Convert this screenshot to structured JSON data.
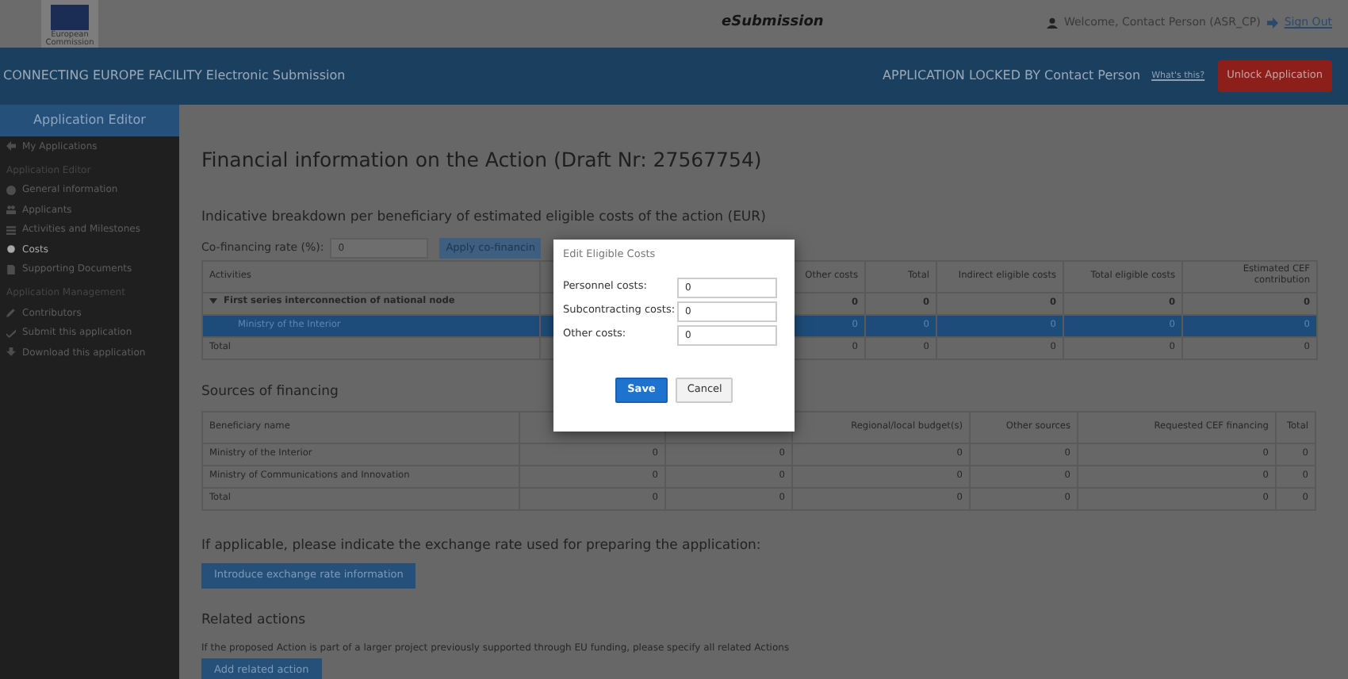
{
  "header": {
    "logo_caption": "European Commission",
    "app_title": "eSubmission",
    "user": "Welcome, Contact Person (ASR_CP)",
    "sign_out": "Sign Out"
  },
  "banner": {
    "title": "CONNECTING EUROPE FACILITY Electronic Submission",
    "lock_status": "APPLICATION LOCKED BY Contact Person",
    "help_link": "What's this?",
    "unlock_button": "Unlock Application"
  },
  "sidebar": {
    "title": "Application Editor",
    "items": [
      {
        "kind": "link",
        "label": "My Applications",
        "selected": false
      },
      {
        "kind": "section",
        "label": "Application Editor"
      },
      {
        "kind": "link",
        "label": "General information",
        "selected": false
      },
      {
        "kind": "link",
        "label": "Applicants",
        "selected": false
      },
      {
        "kind": "link",
        "label": "Activities and Milestones",
        "selected": false
      },
      {
        "kind": "link",
        "label": "Costs",
        "selected": true
      },
      {
        "kind": "link",
        "label": "Supporting Documents",
        "selected": false
      },
      {
        "kind": "section",
        "label": "Application Management"
      },
      {
        "kind": "link",
        "label": "Contributors",
        "selected": false
      },
      {
        "kind": "link",
        "label": "Submit this application",
        "selected": false
      },
      {
        "kind": "link",
        "label": "Download this application",
        "selected": false
      }
    ]
  },
  "page_title": "Financial information on the Action (Draft Nr: 27567754)",
  "breakdown": {
    "title": "Indicative breakdown per beneficiary of estimated eligible costs of the action (EUR)",
    "rate_label": "Co-financing rate (%):",
    "rate_value": "0",
    "apply_button": "Apply co-financin",
    "columns": [
      "Activities",
      "",
      "",
      "Other costs",
      "Total",
      "Indirect eligible costs",
      "Total eligible costs",
      "Estimated CEF contribution"
    ],
    "rows": [
      {
        "kind": "group",
        "expanded": true,
        "selected": false,
        "name": "First series interconnection of national node",
        "values": [
          "0",
          "0",
          "0",
          "0",
          "0"
        ]
      },
      {
        "kind": "item",
        "selected": true,
        "name": "Ministry of the Interior",
        "values": [
          "0",
          "0",
          "0",
          "0",
          "0"
        ]
      },
      {
        "kind": "total",
        "selected": false,
        "name": "Total",
        "values": [
          "0",
          "0",
          "0",
          "0",
          "0"
        ]
      }
    ]
  },
  "sources": {
    "title": "Sources of financing",
    "columns": [
      "Beneficiary name",
      "",
      "",
      "Regional/local budget(s)",
      "Other sources",
      "Requested CEF financing",
      "Total"
    ],
    "rows": [
      {
        "name": "Ministry of the Interior",
        "values": [
          "0",
          "0",
          "0",
          "0",
          "0",
          "0"
        ]
      },
      {
        "name": "Ministry of Communications and Innovation",
        "values": [
          "0",
          "0",
          "0",
          "0",
          "0",
          "0"
        ]
      },
      {
        "name": "Total",
        "values": [
          "0",
          "0",
          "0",
          "0",
          "0",
          "0"
        ]
      }
    ]
  },
  "exchange": {
    "text": "If applicable, please indicate the exchange rate used for preparing the application:",
    "button": "Introduce exchange rate information"
  },
  "related": {
    "title": "Related actions",
    "text": "If the proposed Action is part of a larger project previously supported through EU funding, please specify all related Actions",
    "button": "Add related action"
  },
  "dialog": {
    "title": "Edit Eligible Costs",
    "fields": [
      {
        "label": "Personnel costs:",
        "value": "0"
      },
      {
        "label": "Subcontracting costs:",
        "value": "0"
      },
      {
        "label": "Other costs:",
        "value": "0"
      }
    ],
    "save": "Save",
    "cancel": "Cancel"
  }
}
